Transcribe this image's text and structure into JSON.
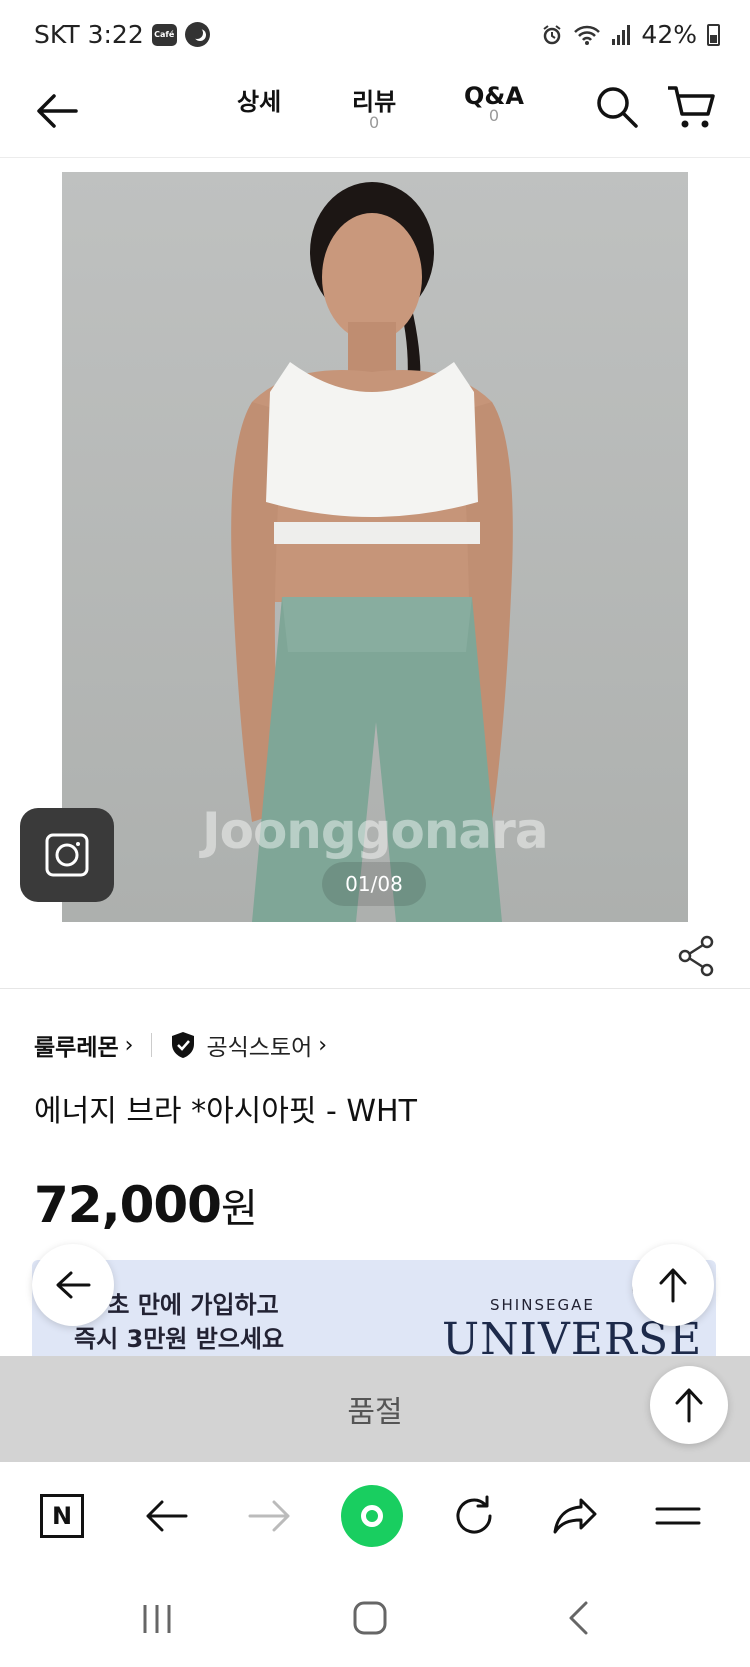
{
  "status_bar": {
    "carrier": "SKT",
    "time": "3:22",
    "cafe_badge": "Café",
    "battery": "42%",
    "icons": [
      "cafe-icon",
      "moon-icon",
      "alarm-icon",
      "wifi-icon",
      "signal-icon",
      "battery-icon"
    ]
  },
  "top_nav": {
    "tabs": [
      {
        "label": "상세",
        "count": ""
      },
      {
        "label": "리뷰",
        "count": "0"
      },
      {
        "label": "Q&A",
        "count": "0"
      }
    ]
  },
  "product_image": {
    "watermark": "Joonggonara",
    "counter": "01/08"
  },
  "product": {
    "brand": "룰루레몬",
    "store_label": "공식스토어",
    "name": "에너지 브라 *아시아핏 - WHT",
    "price": "72,000",
    "price_unit": "원"
  },
  "banner": {
    "line1": "10초 만에 가입하고",
    "line2": "즉시 3만원 받으세요",
    "brand_small": "SHINSEGAE",
    "brand_big": "UNIVERSE"
  },
  "sold_out": {
    "label": "품절"
  },
  "browser_bar": {
    "n_logo": "N",
    "icons": [
      "n-home-icon",
      "back-arrow-icon",
      "forward-arrow-icon",
      "green-dot-icon",
      "refresh-icon",
      "share-arrow-icon",
      "menu-icon"
    ]
  },
  "colors": {
    "accent_green": "#19ce60",
    "soldout_bg": "#d3d3d3",
    "banner_bg": "#dfe6f6",
    "image_bg": "#b8bbba"
  }
}
